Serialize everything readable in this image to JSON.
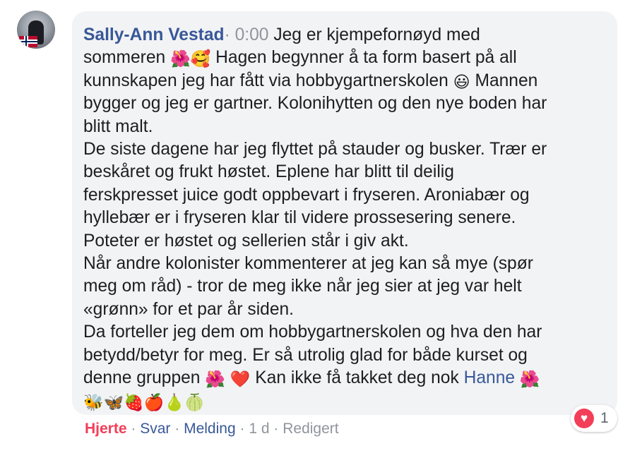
{
  "author": "Sally-Ann Vestad",
  "timestamp": "0:00",
  "lines": [
    [
      "Jeg er kjempefornøyd med"
    ],
    [
      "sommeren ",
      {
        "e": "🌺"
      },
      {
        "e": "🥰"
      },
      " Hagen begynner å ta form basert på all"
    ],
    [
      "kunnskapen jeg har fått via hobbygartnerskolen ",
      {
        "e": "😃"
      },
      " Mannen"
    ],
    [
      "bygger og jeg er gartner. Kolonihytten og den nye boden har"
    ],
    [
      "blitt malt."
    ],
    [
      "De siste dagene har jeg flyttet på stauder og busker. Trær er"
    ],
    [
      "beskåret og frukt høstet. Eplene har blitt til deilig"
    ],
    [
      "ferskpresset juice godt oppbevart i fryseren. Aroniabær og"
    ],
    [
      "hyllebær er i fryseren klar til videre prossesering senere."
    ],
    [
      "Poteter er høstet og sellerien står i giv akt."
    ],
    [
      "Når andre kolonister kommenterer at jeg kan så mye (spør"
    ],
    [
      "meg om råd) - tror de meg ikke når jeg sier at jeg var helt"
    ],
    [
      "«grønn» for et par år siden."
    ],
    [
      "Da forteller jeg dem om hobbygartnerskolen og hva den har"
    ],
    [
      "betydd/betyr for meg. Er så utrolig glad for både kurset og"
    ],
    [
      "denne gruppen ",
      {
        "e": "🌺"
      },
      " ",
      {
        "e": "❤️"
      },
      " Kan ikke få takket deg nok ",
      {
        "m": "Hanne"
      },
      " ",
      {
        "e": "🌺"
      }
    ],
    [
      {
        "e": "🐝"
      },
      {
        "e": "🦋"
      },
      {
        "e": "🍓"
      },
      {
        "e": "🍎"
      },
      {
        "e": "🍐"
      },
      {
        "e": "🍈"
      }
    ]
  ],
  "reaction": {
    "icon": "heart-icon",
    "count": "1",
    "color": "#f33e58"
  },
  "actions": {
    "like": "Hjerte",
    "reply": "Svar",
    "message": "Melding",
    "age": "1 d",
    "edited": "Redigert",
    "sep": "·"
  },
  "colors": {
    "link": "#385898",
    "meta": "#90949c",
    "bubble": "#f2f3f5"
  }
}
